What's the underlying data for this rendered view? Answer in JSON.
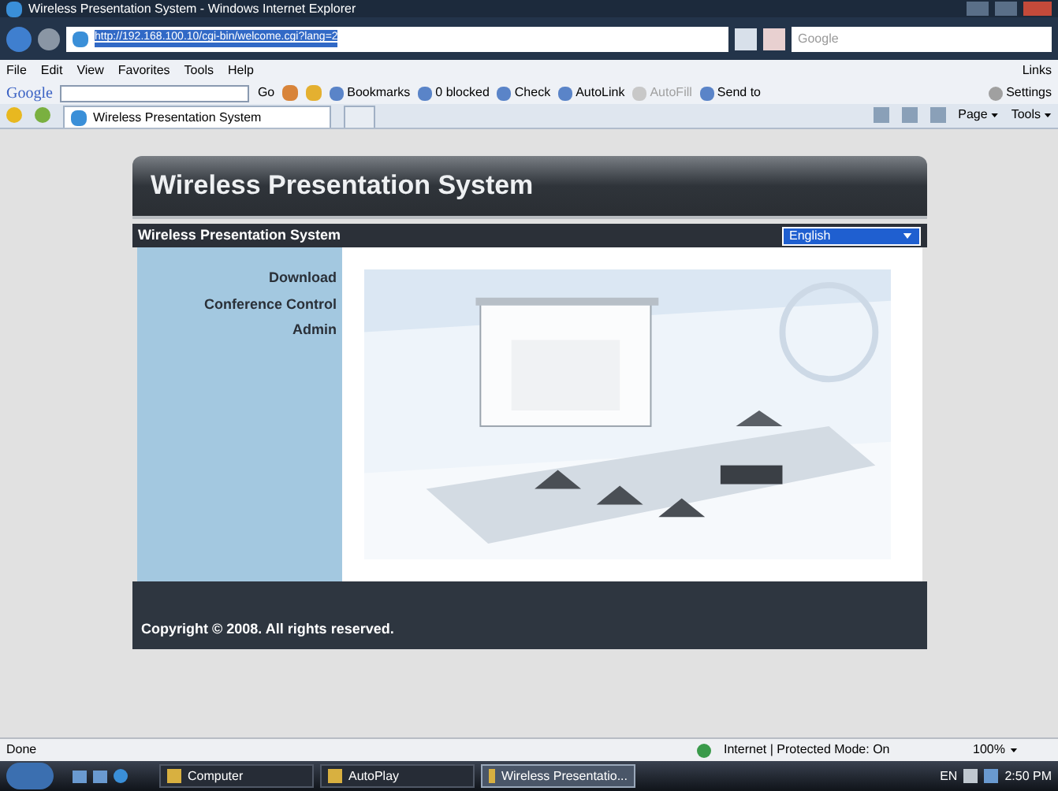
{
  "window": {
    "title": "Wireless Presentation System - Windows Internet Explorer"
  },
  "address_bar": {
    "url": "http://192.168.100.10/cgi-bin/welcome.cgi?lang=2",
    "search_placeholder": "Google"
  },
  "menu": [
    "File",
    "Edit",
    "View",
    "Favorites",
    "Tools",
    "Help"
  ],
  "links_label": "Links",
  "google_toolbar": {
    "logo": "Google",
    "go": "Go",
    "items": [
      {
        "label": "Bookmarks",
        "disabled": false
      },
      {
        "label": "0 blocked",
        "disabled": false
      },
      {
        "label": "Check",
        "disabled": false
      },
      {
        "label": "AutoLink",
        "disabled": false
      },
      {
        "label": "AutoFill",
        "disabled": true
      },
      {
        "label": "Send to",
        "disabled": false
      }
    ],
    "settings": "Settings"
  },
  "tab": {
    "label": "Wireless Presentation System"
  },
  "command_bar": [
    "Page",
    "Tools"
  ],
  "page": {
    "banner_title": "Wireless Presentation System",
    "nav_title": "Wireless Presentation System",
    "language": "English",
    "nav_items": [
      "Download",
      "Conference Control",
      "Admin"
    ],
    "copyright": "Copyright © 2008. All rights reserved."
  },
  "status_bar": {
    "text": "Done",
    "zone": "Internet | Protected Mode: On",
    "zoom": "100%"
  },
  "taskbar": {
    "items": [
      {
        "label": "Computer",
        "selected": false
      },
      {
        "label": "AutoPlay",
        "selected": false
      },
      {
        "label": "Wireless Presentatio...",
        "selected": true
      }
    ],
    "language": "EN",
    "clock": "2:50 PM"
  }
}
